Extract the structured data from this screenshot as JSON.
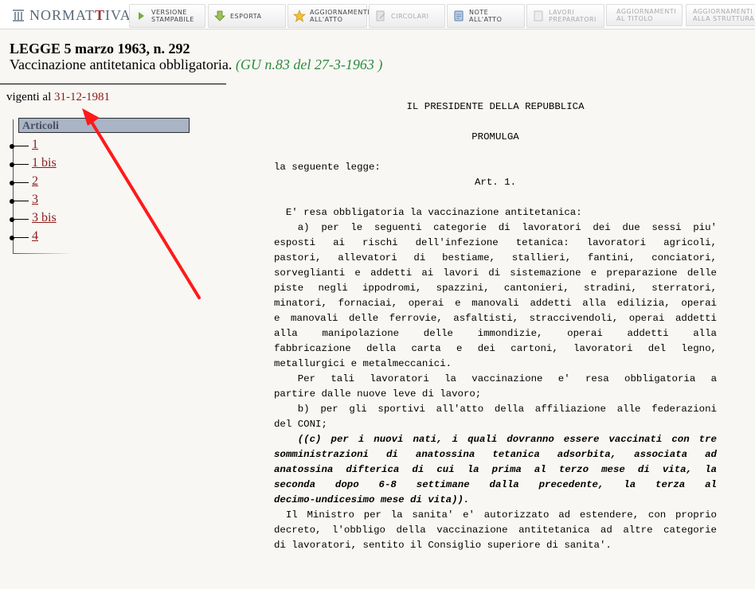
{
  "toolbar": {
    "logo": {
      "prefix": "NORMAT",
      "accent": "T",
      "suffix": "IVA"
    },
    "items": [
      {
        "label": "VERSIONE\nSTAMPABILE",
        "icon": "play-icon",
        "enabled": true
      },
      {
        "label": "ESPORTA",
        "icon": "download-arrow-icon",
        "enabled": true
      },
      {
        "label": "AGGIORNAMENTI\nALL'ATTO",
        "icon": "star-icon",
        "enabled": true
      },
      {
        "label": "CIRCOLARI",
        "icon": "edit-document-icon",
        "enabled": false
      },
      {
        "label": "NOTE\nALL'ATTO",
        "icon": "notes-icon",
        "enabled": true
      },
      {
        "label": "LAVORI\nPREPARATORI",
        "icon": "document-icon",
        "enabled": false
      },
      {
        "label": "AGGIORNAMENTI\nAL TITOLO",
        "icon": "",
        "enabled": false
      },
      {
        "label": "AGGIORNAMENTI\nALLA STRUTTURA",
        "icon": "",
        "enabled": false
      }
    ]
  },
  "header": {
    "title": "LEGGE 5 marzo 1963, n. 292",
    "subtitle": "Vaccinazione antitetanica obbligatoria.",
    "gazzetta": "(GU n.83 del 27-3-1963 )"
  },
  "vigenti": {
    "label": "vigenti al",
    "date": "31-12-1981"
  },
  "articoli": {
    "header": "Articoli",
    "items": [
      "1",
      "1 bis",
      "2",
      "3",
      "3 bis",
      "4"
    ]
  },
  "text": {
    "president": "IL PRESIDENTE DELLA REPUBBLICA",
    "promulga": "PROMULGA",
    "seguente": "la seguente legge:",
    "art": "Art. 1.",
    "intro": "  E' resa obbligatoria la vaccinazione antitetanica:",
    "para_a": [
      "    a)  per  le  seguenti  categorie di lavoratori dei due sessi piu'",
      "esposti ai rischi dell'infezione tetanica: lavoratori agricoli,",
      "pastori, allevatori di bestiame, stallieri, fantini, conciatori,",
      "sorveglianti e addetti ai lavori di sistemazione e preparazione delle",
      "piste negli ippodromi, spazzini, cantonieri, stradini, sterratori,",
      "minatori, fornaciai, operai e manovali addetti alla edilizia, operai",
      "e manovali delle ferrovie, asfaltisti, straccivendoli, operai addetti",
      "alla manipolazione delle immondizie, operai addetti alla",
      "fabbricazione della carta e dei cartoni, lavoratori del legno,",
      "metallurgici e metalmeccanici."
    ],
    "para_tali": [
      "    Per  tali  lavoratori  la  vaccinazione  e'  resa  obbligatoria a",
      "partire dalle nuove leve di lavoro;"
    ],
    "para_b": [
      "    b)  per gli sportivi all'atto della affiliazione alle federazioni",
      "del CONI;"
    ],
    "para_c": [
      "    ((c)  per i nuovi nati, i quali dovranno essere vaccinati con tre",
      "somministrazioni di anatossina tetanica adsorbita, associata ad",
      "anatossina difterica di cui la prima al terzo mese di vita, la",
      "seconda dopo 6-8 settimane dalla precedente, la terza al",
      "decimo-undicesimo mese di vita))."
    ],
    "para_min": [
      "  Il Ministro per la sanita' e' autorizzato ad estendere, con proprio",
      "decreto, l'obbligo della vaccinazione antitetanica ad altre categorie",
      "di lavoratori, sentito il Consiglio superiore di sanita'."
    ]
  },
  "colors": {
    "link": "#8b1a1a",
    "gazzetta": "#2e8b3e",
    "articoli_header_bg": "#a9b4c6",
    "annotation_arrow": "#ff1a1a"
  }
}
